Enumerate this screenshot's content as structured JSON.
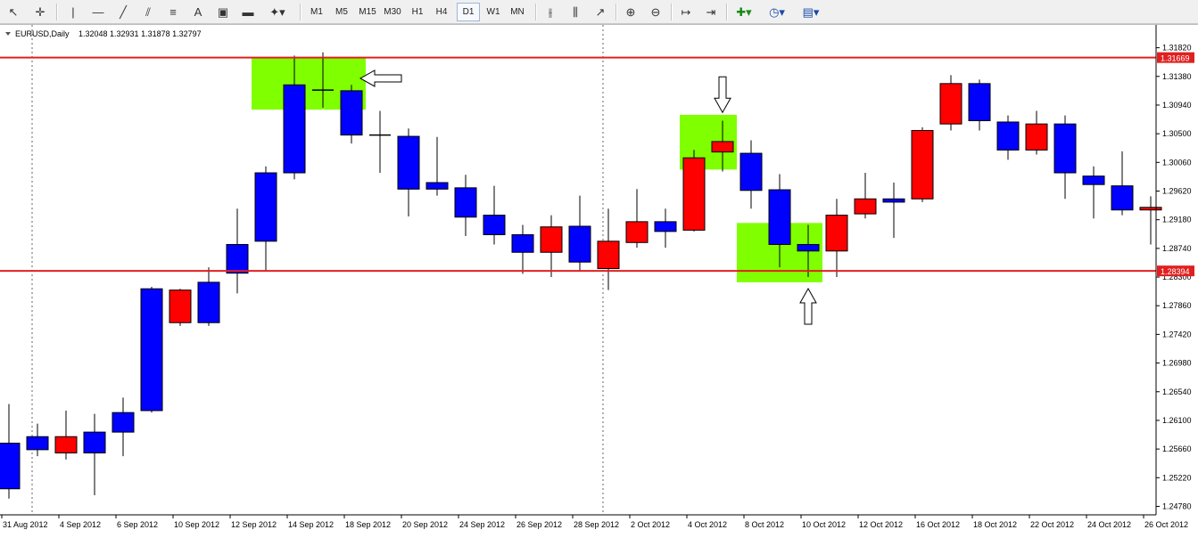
{
  "toolbar": {
    "timeframes": [
      "M1",
      "M5",
      "M15",
      "M30",
      "H1",
      "H4",
      "D1",
      "W1",
      "MN"
    ],
    "selected_timeframe": "D1"
  },
  "header": {
    "symbol": "EURUSD,Daily",
    "ohlc": "1.32048 1.32931 1.31878 1.32797"
  },
  "chart_data": {
    "type": "candlestick",
    "symbol": "EURUSD",
    "timeframe": "Daily",
    "ylim": [
      1.2465,
      1.3217
    ],
    "y_ticks": [
      "1.31820",
      "1.31380",
      "1.30940",
      "1.30500",
      "1.30060",
      "1.29620",
      "1.29180",
      "1.28740",
      "1.28300",
      "1.27860",
      "1.27420",
      "1.26980",
      "1.26540",
      "1.26100",
      "1.25660",
      "1.25220",
      "1.24780"
    ],
    "x_labels": [
      "31 Aug 2012",
      "4 Sep 2012",
      "6 Sep 2012",
      "10 Sep 2012",
      "12 Sep 2012",
      "14 Sep 2012",
      "18 Sep 2012",
      "20 Sep 2012",
      "24 Sep 2012",
      "26 Sep 2012",
      "28 Sep 2012",
      "2 Oct 2012",
      "4 Oct 2012",
      "8 Oct 2012",
      "10 Oct 2012",
      "12 Oct 2012",
      "16 Oct 2012",
      "18 Oct 2012",
      "22 Oct 2012",
      "24 Oct 2012",
      "26 Oct 2012"
    ],
    "candles": [
      {
        "o": 1.2575,
        "h": 1.2635,
        "l": 1.249,
        "c": 1.2505
      },
      {
        "o": 1.2585,
        "h": 1.2605,
        "l": 1.2555,
        "c": 1.2565
      },
      {
        "o": 1.256,
        "h": 1.2625,
        "l": 1.255,
        "c": 1.2585
      },
      {
        "o": 1.2592,
        "h": 1.262,
        "l": 1.2495,
        "c": 1.256
      },
      {
        "o": 1.2622,
        "h": 1.2645,
        "l": 1.2555,
        "c": 1.2592
      },
      {
        "o": 1.2812,
        "h": 1.2815,
        "l": 1.2622,
        "c": 1.2625
      },
      {
        "o": 1.276,
        "h": 1.2812,
        "l": 1.2755,
        "c": 1.281
      },
      {
        "o": 1.2822,
        "h": 1.2845,
        "l": 1.2755,
        "c": 1.276
      },
      {
        "o": 1.288,
        "h": 1.2935,
        "l": 1.2805,
        "c": 1.2836
      },
      {
        "o": 1.299,
        "h": 1.3,
        "l": 1.284,
        "c": 1.2885
      },
      {
        "o": 1.3125,
        "h": 1.317,
        "l": 1.298,
        "c": 1.299
      },
      {
        "o": 1.3115,
        "h": 1.3175,
        "l": 1.309,
        "c": 1.3117
      },
      {
        "o": 1.3116,
        "h": 1.3125,
        "l": 1.3035,
        "c": 1.3048
      },
      {
        "o": 1.3048,
        "h": 1.3085,
        "l": 1.299,
        "c": 1.3047
      },
      {
        "o": 1.3046,
        "h": 1.3058,
        "l": 1.2923,
        "c": 1.2965
      },
      {
        "o": 1.2975,
        "h": 1.3045,
        "l": 1.2955,
        "c": 1.2965
      },
      {
        "o": 1.2967,
        "h": 1.2987,
        "l": 1.2893,
        "c": 1.2922
      },
      {
        "o": 1.2925,
        "h": 1.297,
        "l": 1.288,
        "c": 1.2895
      },
      {
        "o": 1.2895,
        "h": 1.291,
        "l": 1.2835,
        "c": 1.2868
      },
      {
        "o": 1.2868,
        "h": 1.2925,
        "l": 1.283,
        "c": 1.2907
      },
      {
        "o": 1.2908,
        "h": 1.2955,
        "l": 1.284,
        "c": 1.2853
      },
      {
        "o": 1.2843,
        "h": 1.2935,
        "l": 1.281,
        "c": 1.2885
      },
      {
        "o": 1.2883,
        "h": 1.2965,
        "l": 1.2875,
        "c": 1.2915
      },
      {
        "o": 1.2915,
        "h": 1.2935,
        "l": 1.2875,
        "c": 1.29
      },
      {
        "o": 1.2902,
        "h": 1.3025,
        "l": 1.29,
        "c": 1.3013
      },
      {
        "o": 1.3022,
        "h": 1.307,
        "l": 1.2992,
        "c": 1.3038
      },
      {
        "o": 1.302,
        "h": 1.304,
        "l": 1.2935,
        "c": 1.2963
      },
      {
        "o": 1.2964,
        "h": 1.2988,
        "l": 1.2845,
        "c": 1.288
      },
      {
        "o": 1.288,
        "h": 1.291,
        "l": 1.283,
        "c": 1.287
      },
      {
        "o": 1.287,
        "h": 1.295,
        "l": 1.283,
        "c": 1.2925
      },
      {
        "o": 1.2927,
        "h": 1.299,
        "l": 1.292,
        "c": 1.295
      },
      {
        "o": 1.295,
        "h": 1.2975,
        "l": 1.289,
        "c": 1.2945
      },
      {
        "o": 1.295,
        "h": 1.306,
        "l": 1.2945,
        "c": 1.3055
      },
      {
        "o": 1.3065,
        "h": 1.314,
        "l": 1.3055,
        "c": 1.3127
      },
      {
        "o": 1.3127,
        "h": 1.3133,
        "l": 1.3055,
        "c": 1.307
      },
      {
        "o": 1.3068,
        "h": 1.3078,
        "l": 1.301,
        "c": 1.3025
      },
      {
        "o": 1.3025,
        "h": 1.3085,
        "l": 1.3018,
        "c": 1.3065
      },
      {
        "o": 1.3065,
        "h": 1.3078,
        "l": 1.295,
        "c": 1.299
      },
      {
        "o": 1.2985,
        "h": 1.3,
        "l": 1.292,
        "c": 1.2972
      },
      {
        "o": 1.297,
        "h": 1.3023,
        "l": 1.2925,
        "c": 1.2933
      },
      {
        "o": 1.2933,
        "h": 1.2954,
        "l": 1.288,
        "c": 1.2937
      }
    ],
    "levels": [
      {
        "price": 1.31669,
        "label": "1.31669"
      },
      {
        "price": 1.28394,
        "label": "1.28394"
      }
    ],
    "highlights": [
      {
        "from": 9,
        "to": 12,
        "y0": 1.3087,
        "y1": 1.3167
      },
      {
        "from": 24,
        "to": 25,
        "y0": 1.2995,
        "y1": 1.3079
      },
      {
        "from": 26,
        "to": 28,
        "y0": 1.2822,
        "y1": 1.2913
      }
    ],
    "arrows": [
      {
        "dir": "left",
        "index": 13,
        "price": 1.3135
      },
      {
        "dir": "down",
        "index": 25,
        "price": 1.311
      },
      {
        "dir": "up",
        "index": 28,
        "price": 1.2785
      }
    ],
    "colors": {
      "bull": "#ff0000",
      "bear": "#0000ff",
      "highlight": "#80ff00",
      "level": "#e02020"
    }
  }
}
